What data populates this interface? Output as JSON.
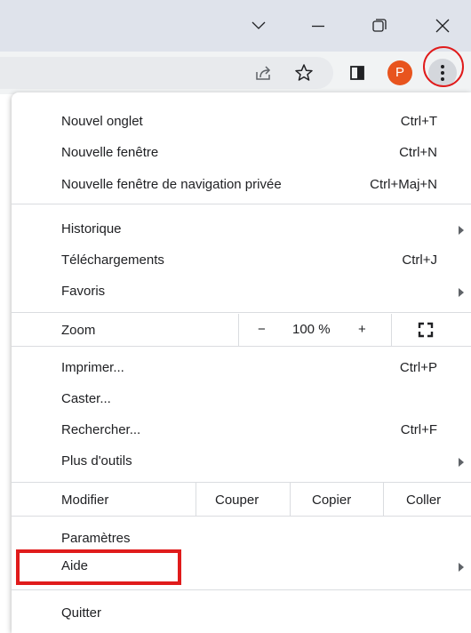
{
  "window": {
    "controls": [
      "chevron-down-icon",
      "minimize-icon",
      "restore-icon",
      "close-icon"
    ]
  },
  "toolbar": {
    "avatar_letter": "P",
    "avatar_color": "#e8541e",
    "icons": [
      "share-icon",
      "bookmark-star-icon",
      "side-panel-icon",
      "kebab-menu-icon"
    ]
  },
  "menu": {
    "group1": [
      {
        "label": "Nouvel onglet",
        "shortcut": "Ctrl+T"
      },
      {
        "label": "Nouvelle fenêtre",
        "shortcut": "Ctrl+N"
      },
      {
        "label": "Nouvelle fenêtre de navigation privée",
        "shortcut": "Ctrl+Maj+N"
      }
    ],
    "group2": [
      {
        "label": "Historique",
        "submenu": true
      },
      {
        "label": "Téléchargements",
        "shortcut": "Ctrl+J"
      },
      {
        "label": "Favoris",
        "submenu": true
      }
    ],
    "zoom": {
      "label": "Zoom",
      "minus": "−",
      "value": "100 %",
      "plus": "+",
      "fullscreen_icon": "fullscreen-icon"
    },
    "group3": [
      {
        "label": "Imprimer...",
        "shortcut": "Ctrl+P"
      },
      {
        "label": "Caster..."
      },
      {
        "label": "Rechercher...",
        "shortcut": "Ctrl+F"
      },
      {
        "label": "Plus d'outils",
        "submenu": true
      }
    ],
    "edit": {
      "label": "Modifier",
      "cut": "Couper",
      "copy": "Copier",
      "paste": "Coller"
    },
    "group4": [
      {
        "label": "Paramètres"
      },
      {
        "label": "Aide",
        "submenu": true
      }
    ],
    "quit": {
      "label": "Quitter"
    }
  },
  "colors": {
    "annotation": "#e01b1b",
    "titlebar": "#dfe3eb",
    "toolbar": "#f1f3f4"
  }
}
